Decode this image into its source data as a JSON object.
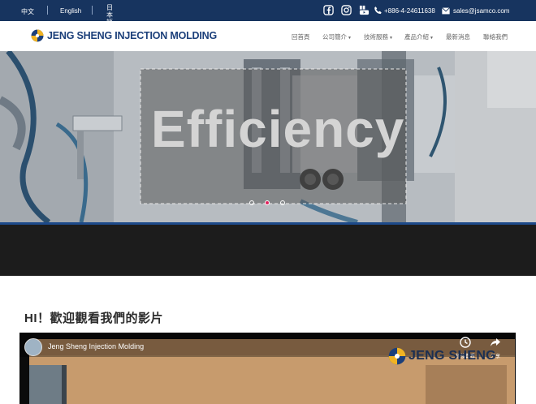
{
  "topbar": {
    "languages": [
      "中文",
      "English",
      "日本語"
    ],
    "phone": "+886-4-24611638",
    "email": "sales@jsamco.com"
  },
  "brand": {
    "logo_text": "JENG SHENG INJECTION MOLDING"
  },
  "nav": {
    "items": [
      {
        "label": "回首頁",
        "has_caret": false
      },
      {
        "label": "公司簡介",
        "has_caret": true
      },
      {
        "label": "技術服務",
        "has_caret": true
      },
      {
        "label": "產品介紹",
        "has_caret": true
      },
      {
        "label": "最新消息",
        "has_caret": false
      },
      {
        "label": "聯絡我們",
        "has_caret": false
      }
    ]
  },
  "hero": {
    "headline": "Efficiency",
    "slide_count": 3,
    "active_slide": 2
  },
  "section": {
    "heading": "HI！歡迎觀看我們的影片"
  },
  "video": {
    "title": "Jeng Sheng Injection Molding",
    "watermark": "JENG SHENG",
    "watch_later": "稍後觀看",
    "share": "分享"
  },
  "colors": {
    "topbar": "#17345f",
    "brand_blue": "#1b3f7a",
    "brand_yellow": "#f0b323",
    "active_dot": "#e0245e",
    "dark_band": "#1c1c1c"
  }
}
